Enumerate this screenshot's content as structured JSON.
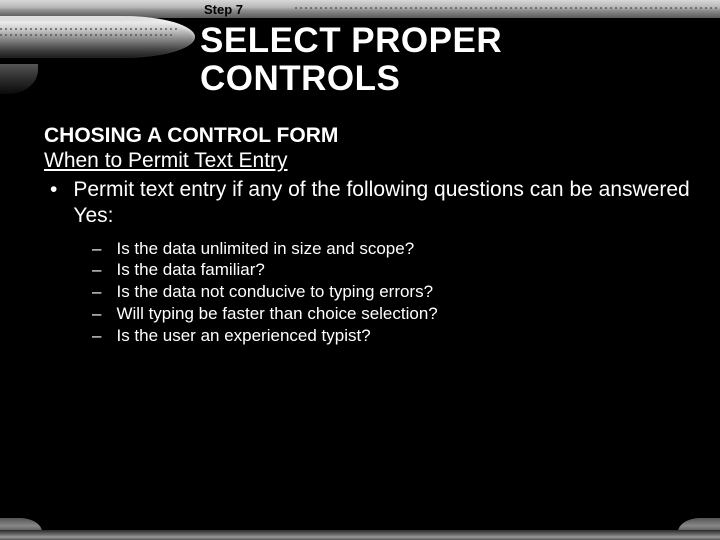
{
  "header": {
    "step": "Step 7",
    "title_line1": "SELECT PROPER",
    "title_line2": "CONTROLS"
  },
  "content": {
    "heading": "CHOSING A CONTROL FORM",
    "subheading": "When to Permit Text Entry",
    "main_bullet": "Permit text entry if any of the following questions can be answered Yes:",
    "sub_bullets": [
      "Is the data unlimited in size and scope?",
      "Is the data familiar?",
      "Is the data not conducive to typing errors?",
      "Will typing be faster than choice selection?",
      "Is the user an experienced typist?"
    ]
  }
}
